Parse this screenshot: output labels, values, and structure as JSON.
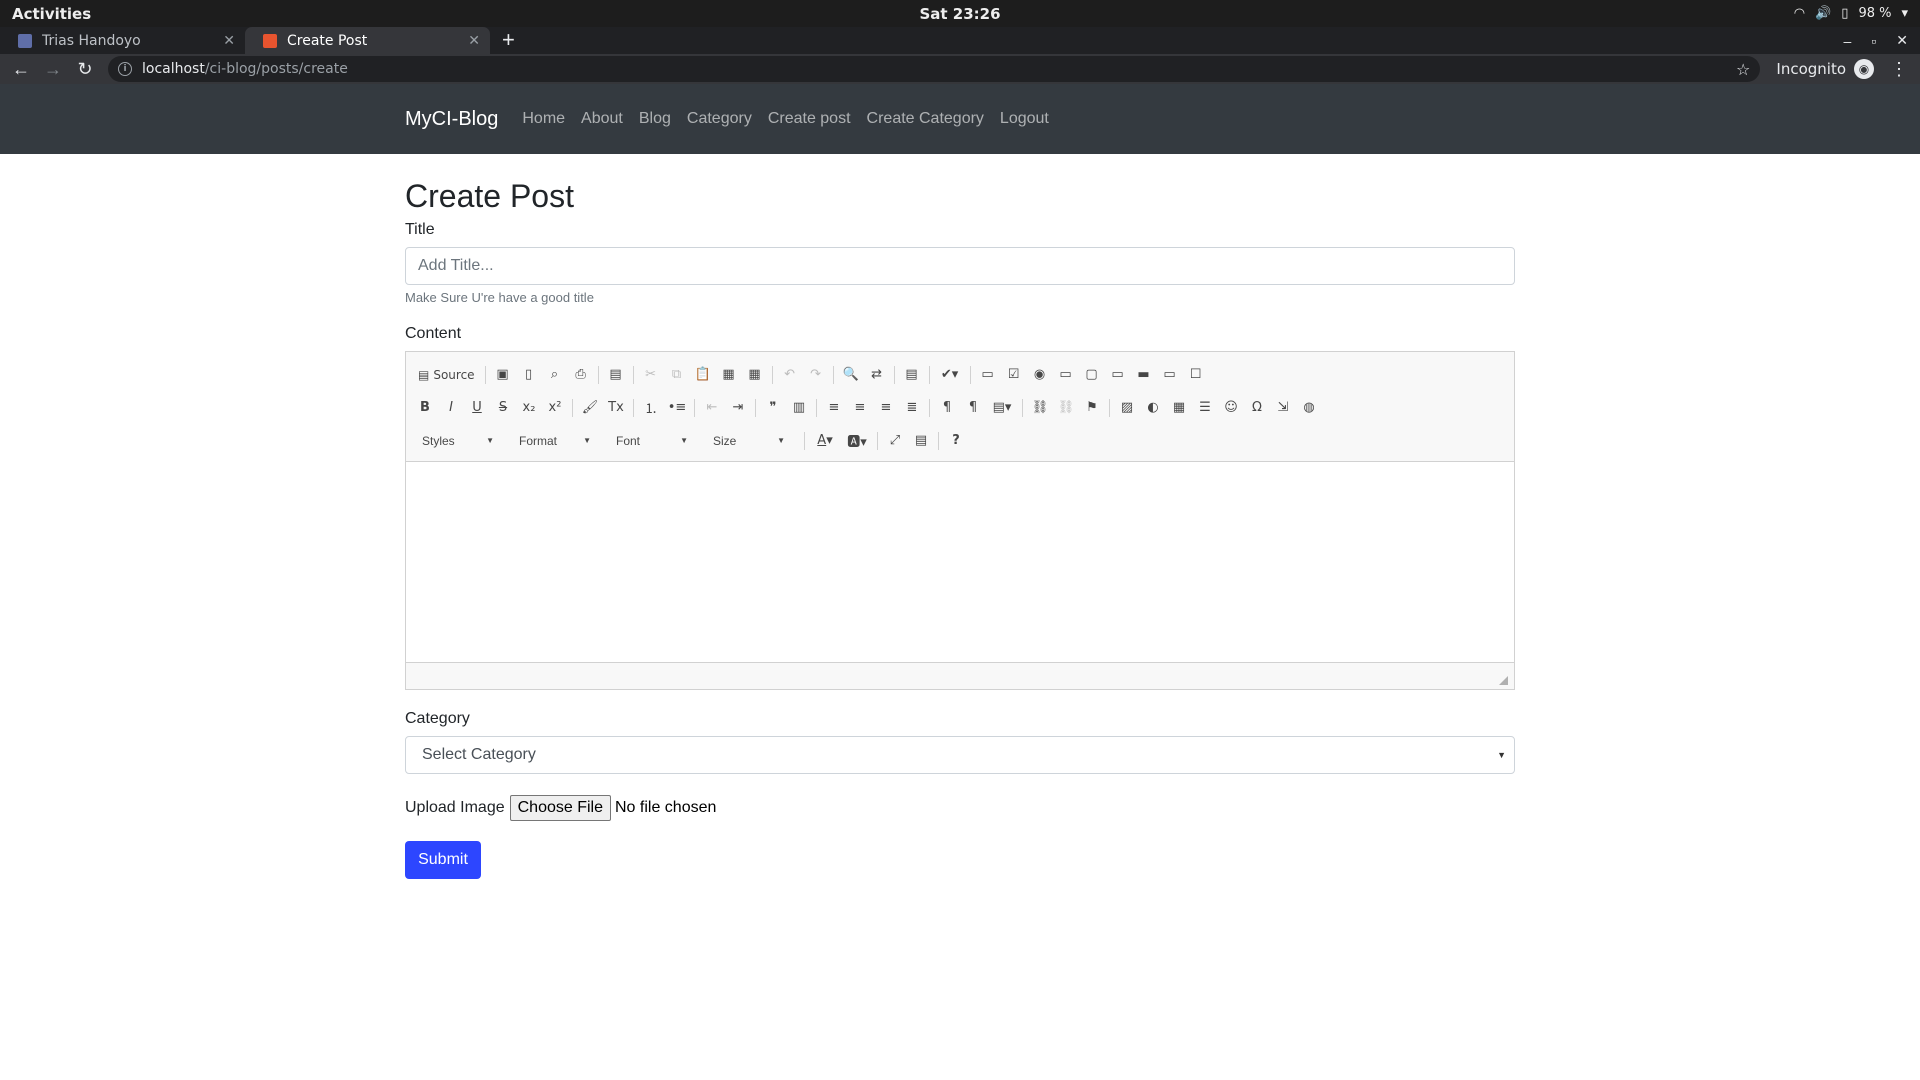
{
  "os": {
    "activities": "Activities",
    "clock": "Sat 23:26",
    "battery": "98 %"
  },
  "browser": {
    "tabs": [
      {
        "label": "Trias Handoyo",
        "active": false
      },
      {
        "label": "Create Post",
        "active": true
      }
    ],
    "url_host": "localhost",
    "url_path": "/ci-blog/posts/create",
    "incognito_label": "Incognito"
  },
  "site_nav": {
    "brand": "MyCI-Blog",
    "links": [
      "Home",
      "About",
      "Blog",
      "Category",
      "Create post",
      "Create Category",
      "Logout"
    ]
  },
  "form": {
    "heading": "Create Post",
    "title_label": "Title",
    "title_placeholder": "Add Title...",
    "title_help": "Make Sure U're have a good title",
    "content_label": "Content",
    "editor": {
      "source_label": "Source",
      "combos": [
        "Styles",
        "Format",
        "Font",
        "Size"
      ]
    },
    "category_label": "Category",
    "category_selected": "Select Category",
    "upload_label": "Upload Image",
    "file_button": "Choose File",
    "file_status": "No file chosen",
    "submit_label": "Submit"
  },
  "colors": {
    "navbar_bg": "#343a40",
    "submit_bg": "#2d46ff"
  }
}
